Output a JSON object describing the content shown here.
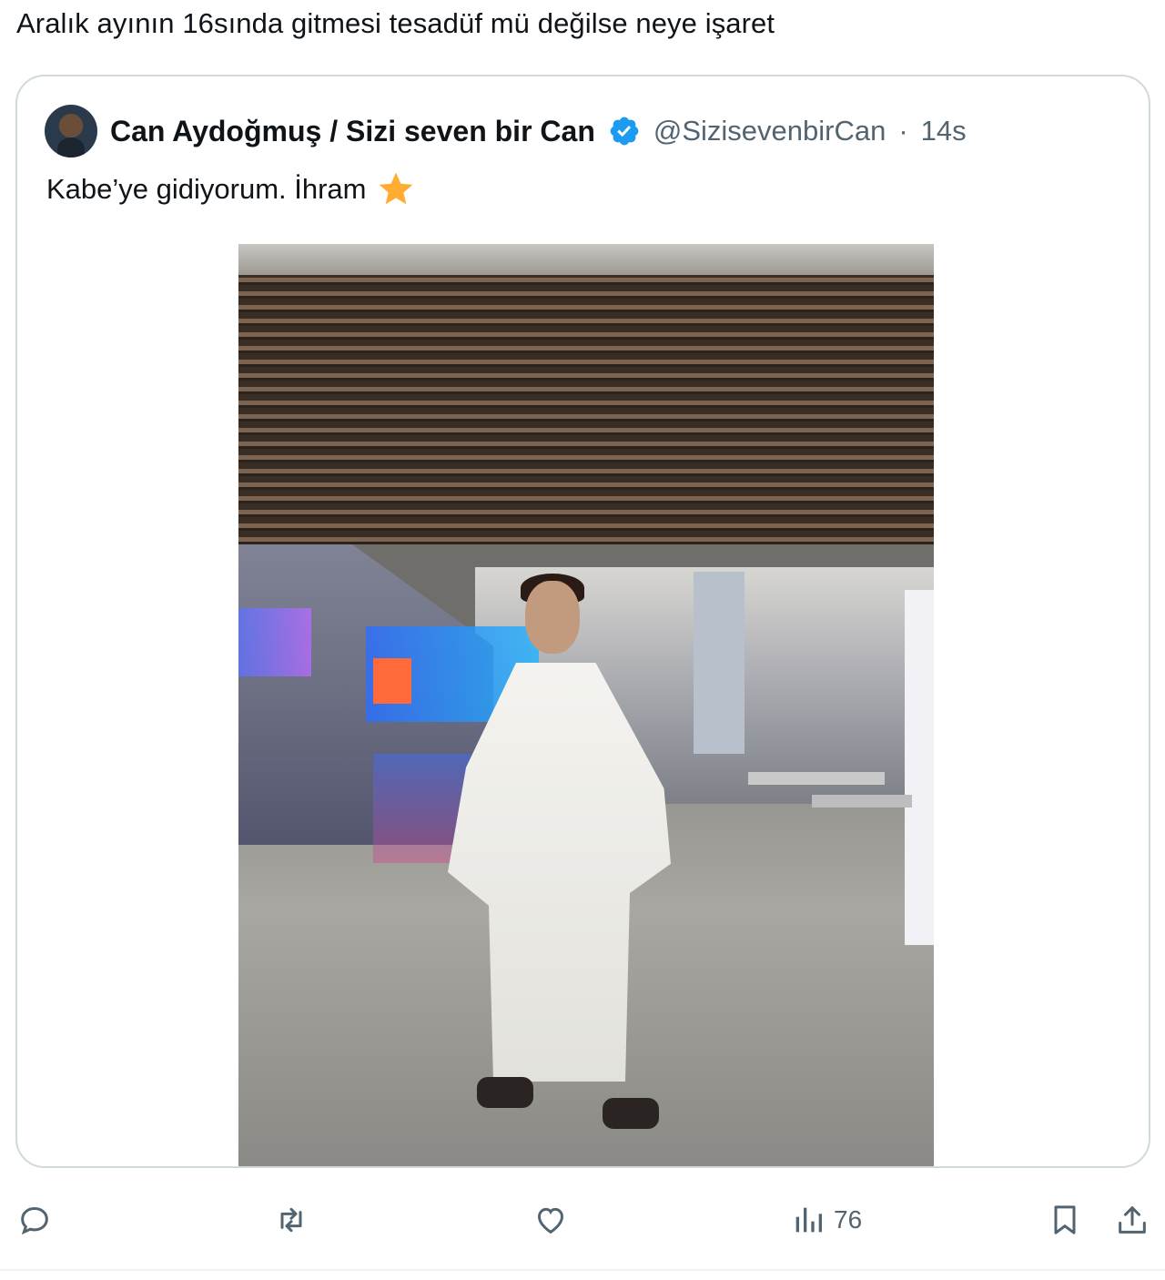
{
  "tweet": {
    "text": "Aralık ayının 16sında gitmesi tesadüf mü değilse neye işaret"
  },
  "quoted": {
    "display_name": "Can Aydoğmuş / Sizi seven bir Can",
    "handle": "@SizisevenbirCan",
    "separator": "·",
    "time": "14s",
    "text": "Kabe’ye gidiyorum. İhram",
    "emoji": "star-icon",
    "verified": true
  },
  "actions": {
    "reply": "reply-icon",
    "retweet": "retweet-icon",
    "like": "heart-icon",
    "views_icon": "views-icon",
    "views_count": "76",
    "bookmark": "bookmark-icon",
    "share": "share-icon"
  },
  "colors": {
    "accent": "#1d9bf0",
    "secondary_text": "#536471",
    "border": "#cfd9de",
    "star": "#ffac33"
  }
}
